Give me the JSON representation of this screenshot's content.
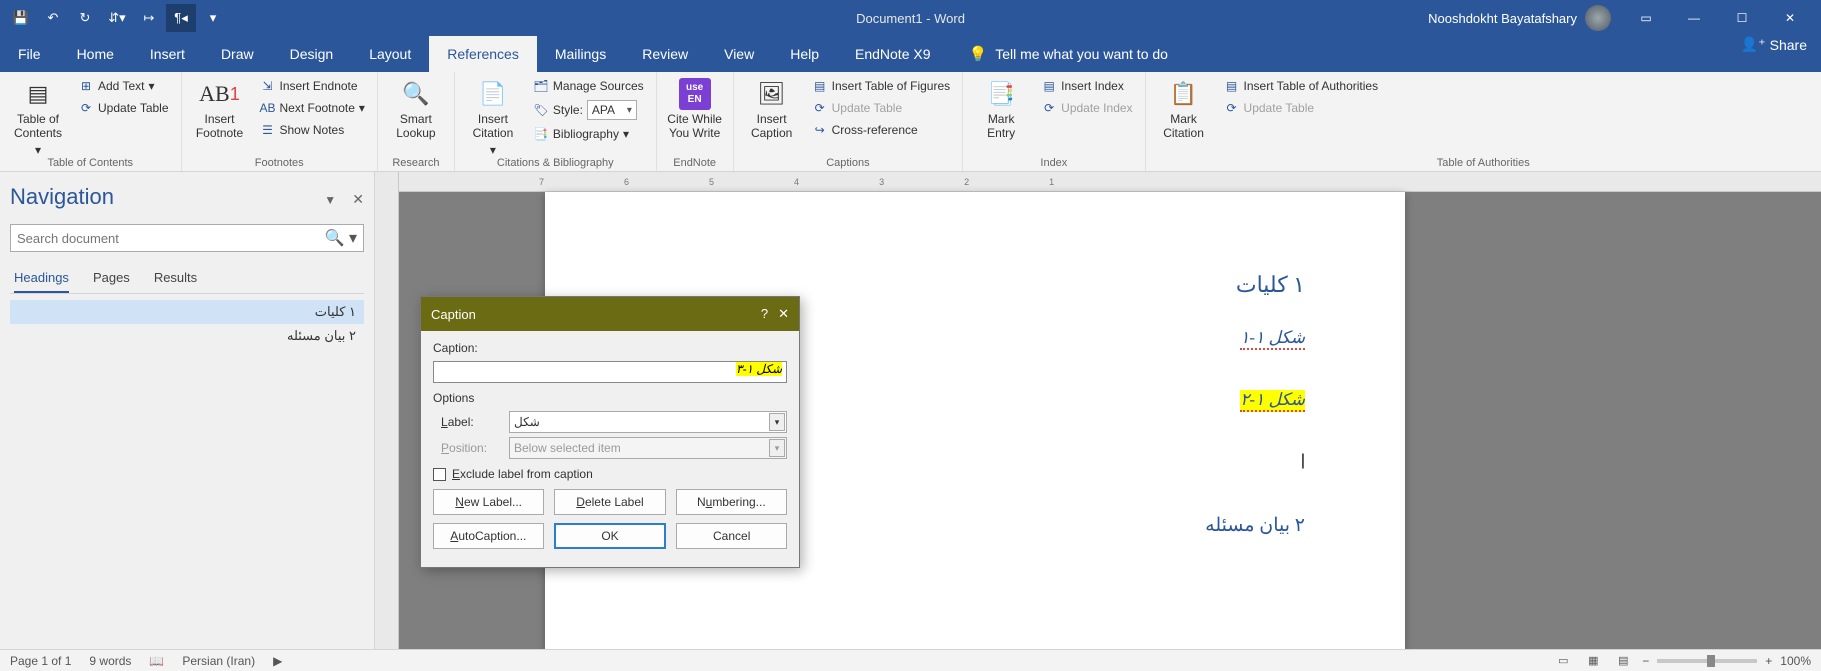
{
  "titlebar": {
    "document_title": "Document1 - Word",
    "user_name": "Nooshdokht Bayatafshary"
  },
  "tabs": {
    "file": "File",
    "home": "Home",
    "insert": "Insert",
    "draw": "Draw",
    "design": "Design",
    "layout": "Layout",
    "references": "References",
    "mailings": "Mailings",
    "review": "Review",
    "view": "View",
    "help": "Help",
    "endnote": "EndNote X9",
    "tellme": "Tell me what you want to do",
    "share": "Share"
  },
  "ribbon": {
    "toc": {
      "big": "Table of\nContents",
      "add_text": "Add Text",
      "update": "Update Table",
      "group": "Table of Contents"
    },
    "footnotes": {
      "big": "Insert\nFootnote",
      "endnote": "Insert Endnote",
      "next": "Next Footnote",
      "show": "Show Notes",
      "group": "Footnotes"
    },
    "research": {
      "big": "Smart\nLookup",
      "group": "Research"
    },
    "citations": {
      "big": "Insert\nCitation",
      "manage": "Manage Sources",
      "style_lbl": "Style:",
      "style_val": "APA",
      "biblio": "Bibliography",
      "group": "Citations & Bibliography"
    },
    "endnote": {
      "big": "Cite While\nYou Write",
      "group": "EndNote"
    },
    "captions": {
      "big": "Insert\nCaption",
      "tof": "Insert Table of Figures",
      "update": "Update Table",
      "cross": "Cross-reference",
      "group": "Captions"
    },
    "index": {
      "big": "Mark\nEntry",
      "insert": "Insert Index",
      "update": "Update Index",
      "group": "Index"
    },
    "toa": {
      "big": "Mark\nCitation",
      "insert": "Insert Table of Authorities",
      "update": "Update Table",
      "group": "Table of Authorities"
    }
  },
  "nav": {
    "title": "Navigation",
    "search_placeholder": "Search document",
    "tabs": {
      "headings": "Headings",
      "pages": "Pages",
      "results": "Results"
    },
    "items": [
      "۱ کلیات",
      "۲ بیان مسئله"
    ]
  },
  "ruler": [
    "7",
    "6",
    "5",
    "4",
    "3",
    "2",
    "1"
  ],
  "document": {
    "h1": "۱   کلیات",
    "fig1": "شکل ۱-۱",
    "fig2": "شکل ۱-۲",
    "h2": "۲   بیان مسئله"
  },
  "dialog": {
    "title": "Caption",
    "caption_label": "Caption:",
    "caption_value": "شکل ۱-۳",
    "options": "Options",
    "label_label": "Label:",
    "label_value": "شکل",
    "position_label": "Position:",
    "position_value": "Below selected item",
    "exclude": "Exclude label from caption",
    "new_label": "New Label...",
    "delete_label": "Delete Label",
    "numbering": "Numbering...",
    "autocaption": "AutoCaption...",
    "ok": "OK",
    "cancel": "Cancel"
  },
  "status": {
    "page": "Page 1 of 1",
    "words": "9 words",
    "lang": "Persian (Iran)",
    "zoom": "100%"
  }
}
